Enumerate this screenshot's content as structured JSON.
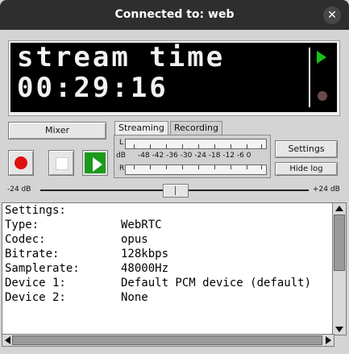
{
  "window": {
    "title": "Connected to: web",
    "close_glyph": "✕"
  },
  "display": {
    "line1": "stream time",
    "line2": "00:29:16",
    "play_indicator": "green-play-icon",
    "record_indicator": "record-dot-icon",
    "indicator_color": "#16c116"
  },
  "controls": {
    "mixer_label": "Mixer",
    "record_icon": "record-icon",
    "stop_icon": "stop-icon",
    "play_icon": "play-icon",
    "record_color": "#e01010",
    "play_color": "#1b9a1b"
  },
  "tabs": [
    {
      "label": "Streaming",
      "active": true
    },
    {
      "label": "Recording",
      "active": false
    }
  ],
  "meter": {
    "left_label": "L",
    "right_label": "R",
    "unit_label": "dB",
    "scale": "-48 -42 -36 -30 -24 -18 -12 -6  0"
  },
  "side_buttons": {
    "settings_label": "Settings",
    "hidelog_label": "Hide log"
  },
  "gain": {
    "min_label": "-24 dB",
    "max_label": "+24 dB",
    "value_db": 0
  },
  "log": {
    "header": "Settings:",
    "rows": [
      {
        "key": "Type:",
        "value": "WebRTC"
      },
      {
        "key": "Codec:",
        "value": "opus"
      },
      {
        "key": "Bitrate:",
        "value": "128kbps"
      },
      {
        "key": "Samplerate:",
        "value": "48000Hz"
      },
      {
        "key": "Device 1:",
        "value": "Default PCM device (default)"
      },
      {
        "key": "Device 2:",
        "value": "None"
      }
    ]
  }
}
